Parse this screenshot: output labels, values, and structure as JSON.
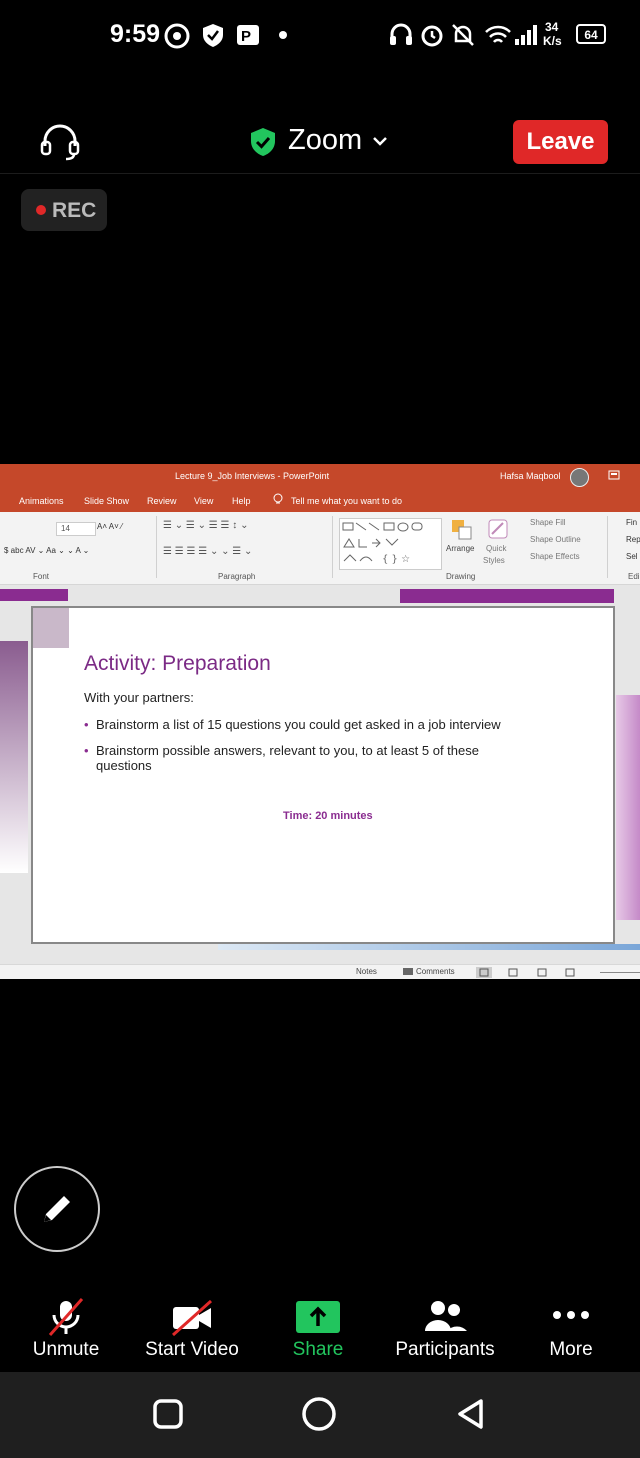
{
  "status_bar": {
    "time": "9:59",
    "net_speed_value": "34",
    "net_speed_unit": "K/s",
    "battery": "64"
  },
  "header": {
    "app_title": "Zoom",
    "leave_label": "Leave",
    "rec_label": "REC"
  },
  "shared_screen": {
    "window_title": "Lecture 9_Job Interviews  -  PowerPoint",
    "user_name": "Hafsa Maqbool",
    "tabs": [
      "Animations",
      "Slide Show",
      "Review",
      "View",
      "Help",
      "Tell me what you want to do"
    ],
    "ribbon": {
      "font_size": "14",
      "group_font": "Font",
      "group_paragraph": "Paragraph",
      "group_drawing": "Drawing",
      "arrange": "Arrange",
      "quick_styles_1": "Quick",
      "quick_styles_2": "Styles",
      "shape_fill": "Shape Fill",
      "shape_outline": "Shape Outline",
      "shape_effects": "Shape Effects",
      "find": "Fin",
      "replace": "Rep",
      "select": "Sel",
      "editing": "Edi"
    },
    "slide": {
      "title": "Activity: Preparation",
      "intro": "With your partners:",
      "bullet_1": "Brainstorm a list of 15 questions you could get asked in a job interview",
      "bullet_2_line1": "Brainstorm possible answers, relevant to you, to at least 5 of these",
      "bullet_2_line2": "questions",
      "time": "Time: 20 minutes"
    },
    "status": {
      "notes": "Notes",
      "comments": "Comments"
    }
  },
  "toolbar": {
    "unmute": "Unmute",
    "start_video": "Start Video",
    "share": "Share",
    "participants": "Participants",
    "more": "More"
  },
  "colors": {
    "leave": "#e02828",
    "share": "#22c55e",
    "ppt_header": "#c5482a",
    "slide_accent": "#8a2c90"
  }
}
